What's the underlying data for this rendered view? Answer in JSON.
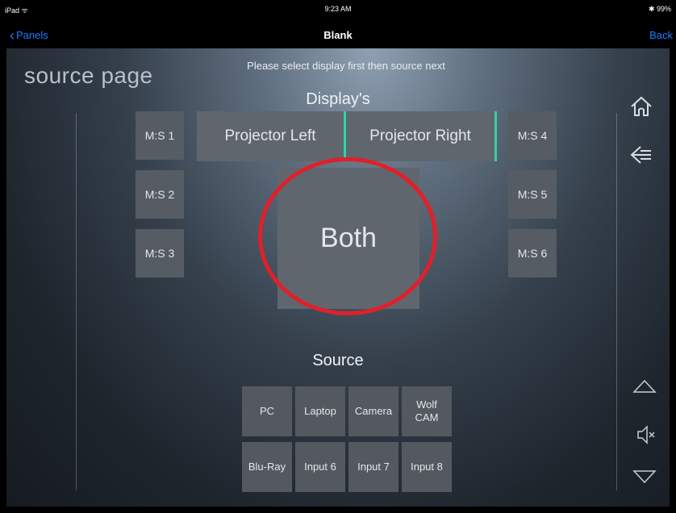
{
  "status_bar": {
    "device": "iPad ᯤ",
    "time": "9:23 AM",
    "battery": "✱ 99%"
  },
  "nav": {
    "back_label": "Panels",
    "title": "Blank",
    "right_label": "Back"
  },
  "page": {
    "title": "source page",
    "instruction": "Please select display first then source next",
    "displays_label": "Display's",
    "source_label": "Source"
  },
  "displays": {
    "ms_left": [
      "M:S 1",
      "M:S 2",
      "M:S 3"
    ],
    "ms_right": [
      "M:S 4",
      "M:S 5",
      "M:S 6"
    ],
    "projector_left": "Projector Left",
    "projector_right": "Projector Right",
    "both": "Both"
  },
  "sources": {
    "row1": [
      "PC",
      "Laptop",
      "Camera",
      "Wolf CAM"
    ],
    "row2": [
      "Blu-Ray",
      "Input 6",
      "Input 7",
      "Input 8"
    ]
  },
  "icons": [
    "home-icon",
    "back-arrow-icon",
    "volume-up-icon",
    "mute-icon",
    "volume-down-icon"
  ],
  "colors": {
    "accent_link": "#1e7bff",
    "highlight_ring": "#e0202a",
    "active_divider": "#2ed6a0"
  }
}
